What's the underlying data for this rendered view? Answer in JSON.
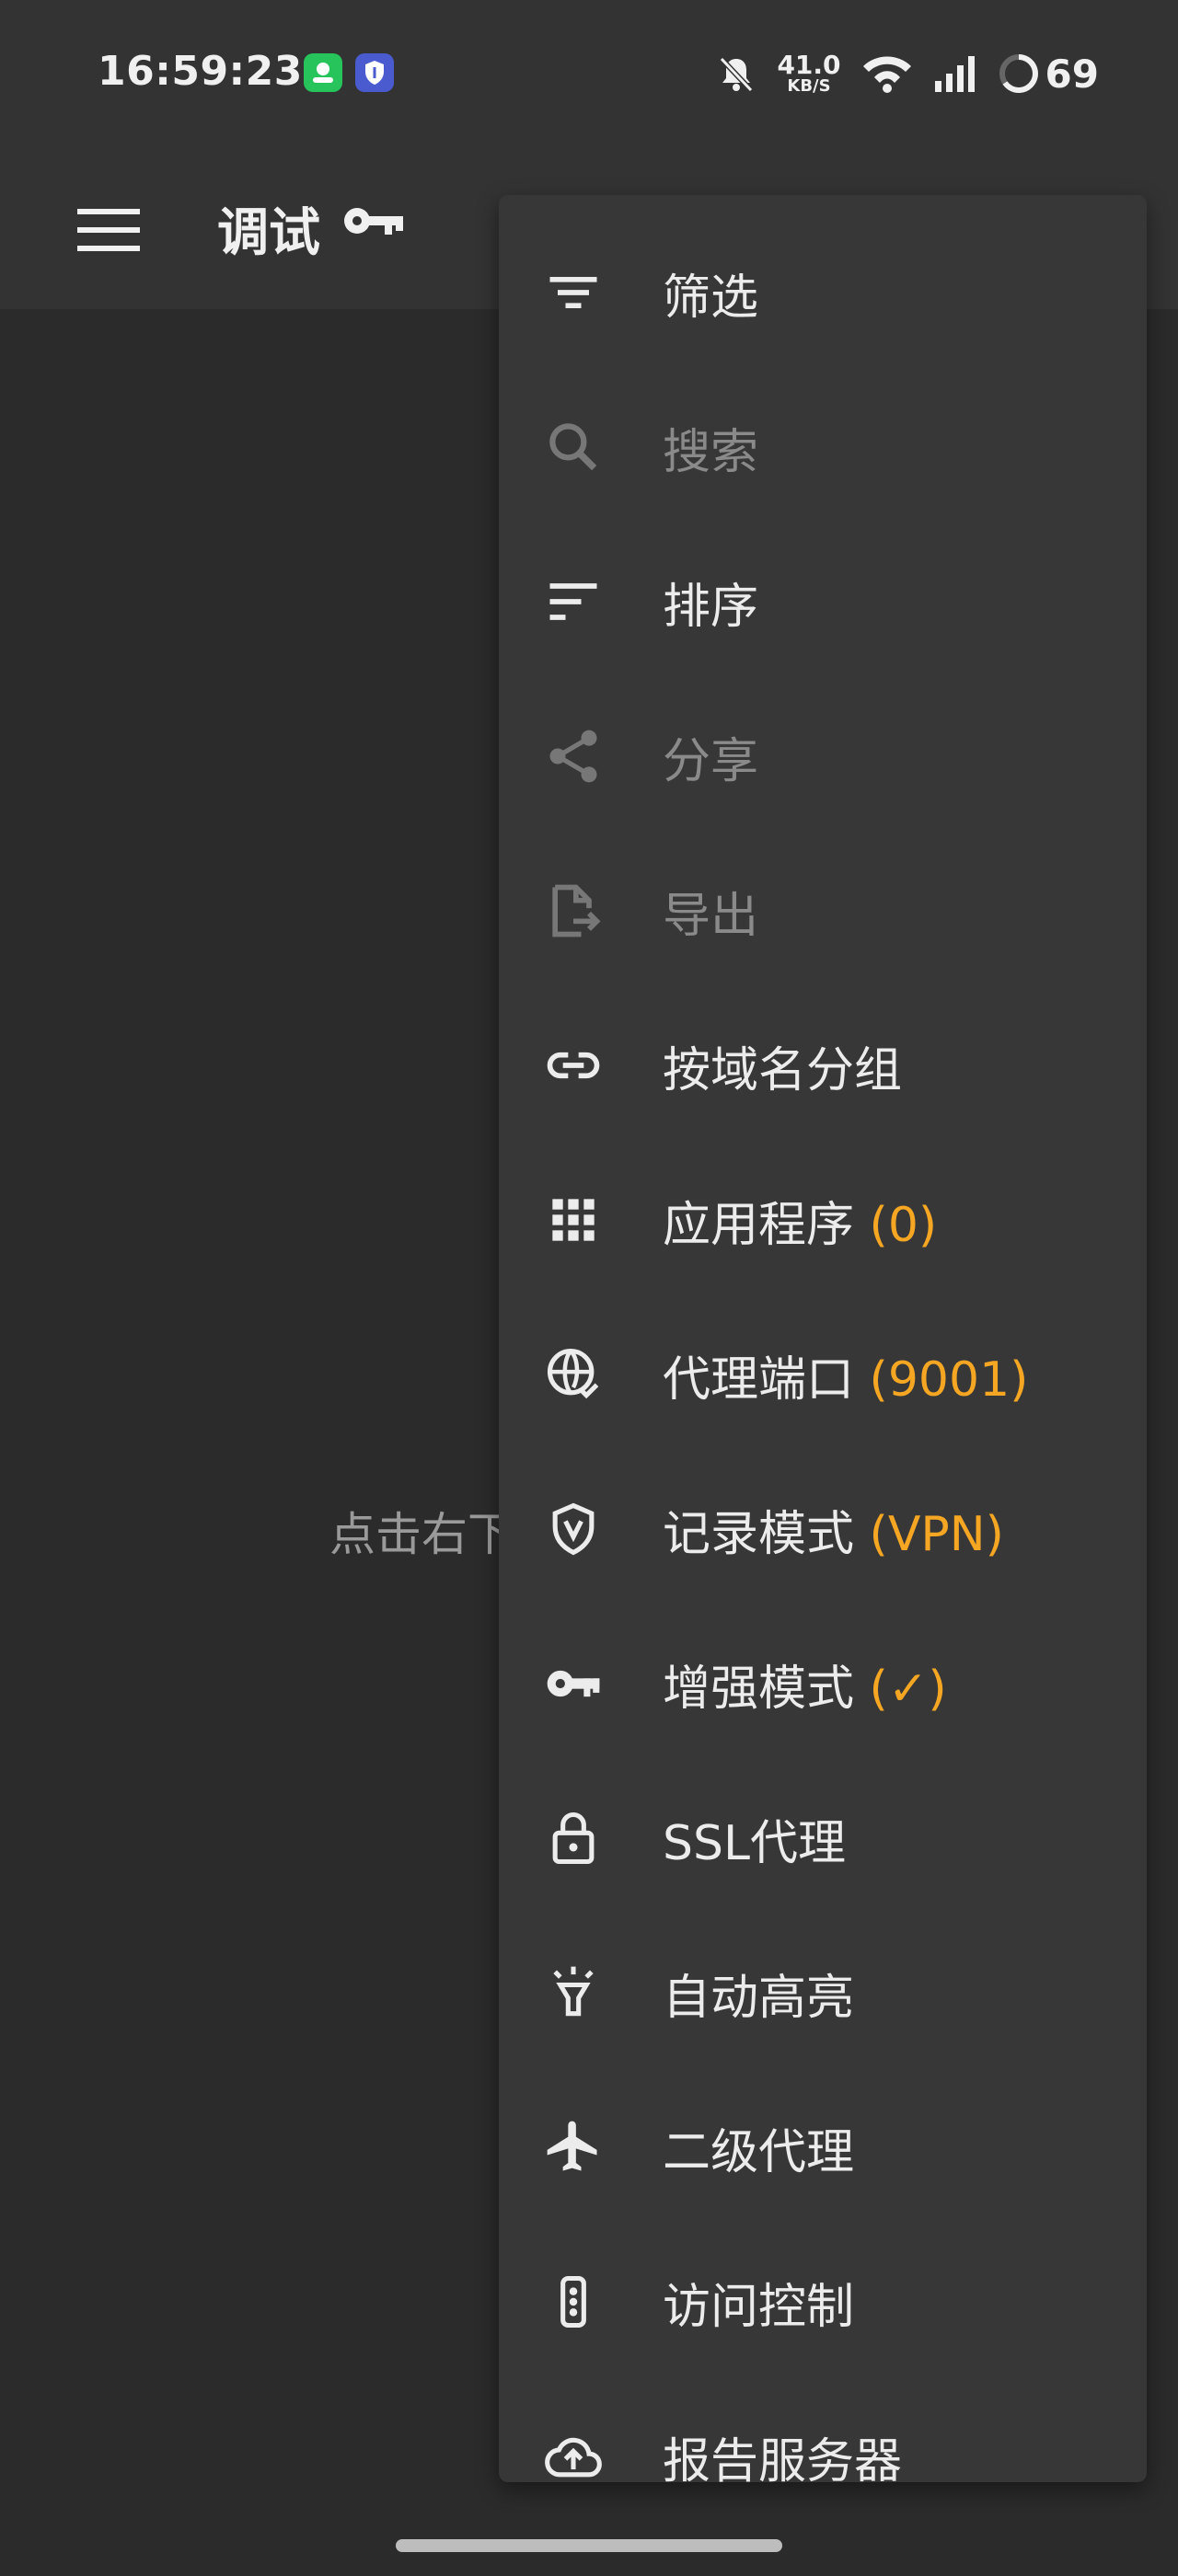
{
  "status_bar": {
    "time": "16:59:23",
    "net_speed_value": "41.0",
    "net_speed_unit": "KB/S",
    "battery": "69",
    "icons": [
      "muted-bell-icon",
      "wifi-icon",
      "signal-icon",
      "battery-ring-icon"
    ]
  },
  "app_bar": {
    "title": "调试",
    "icons": [
      "menu-icon",
      "key-icon"
    ]
  },
  "empty_hint": "点击右下",
  "menu": {
    "items": [
      {
        "id": "filter",
        "label": "筛选",
        "extra": "",
        "icon": "filter-icon",
        "enabled": true
      },
      {
        "id": "search",
        "label": "搜索",
        "extra": "",
        "icon": "search-icon",
        "enabled": false
      },
      {
        "id": "sort",
        "label": "排序",
        "extra": "",
        "icon": "sort-icon",
        "enabled": true
      },
      {
        "id": "share",
        "label": "分享",
        "extra": "",
        "icon": "share-icon",
        "enabled": false
      },
      {
        "id": "export",
        "label": "导出",
        "extra": "",
        "icon": "export-icon",
        "enabled": false
      },
      {
        "id": "group-by-domain",
        "label": "按域名分组",
        "extra": "",
        "icon": "link-icon",
        "enabled": true
      },
      {
        "id": "applications",
        "label": "应用程序",
        "extra": "(0)",
        "icon": "apps-grid-icon",
        "enabled": true
      },
      {
        "id": "proxy-port",
        "label": "代理端口",
        "extra": "(9001)",
        "icon": "globe-check-icon",
        "enabled": true
      },
      {
        "id": "record-mode",
        "label": "记录模式",
        "extra": "(VPN)",
        "icon": "shield-v-icon",
        "enabled": true
      },
      {
        "id": "enhanced-mode",
        "label": "增强模式",
        "extra": "(✓)",
        "icon": "key-icon",
        "enabled": true
      },
      {
        "id": "ssl-proxy",
        "label": "SSL代理",
        "extra": "",
        "icon": "lock-icon",
        "enabled": true
      },
      {
        "id": "auto-highlight",
        "label": "自动高亮",
        "extra": "",
        "icon": "highlight-icon",
        "enabled": true
      },
      {
        "id": "upstream-proxy",
        "label": "二级代理",
        "extra": "",
        "icon": "airplane-icon",
        "enabled": true
      },
      {
        "id": "access-control",
        "label": "访问控制",
        "extra": "",
        "icon": "traffic-light-icon",
        "enabled": true
      },
      {
        "id": "report-server",
        "label": "报告服务器",
        "extra": "",
        "icon": "cloud-upload-icon",
        "enabled": true
      }
    ]
  },
  "colors": {
    "background": "#2b2b2b",
    "bar": "#333333",
    "menu": "#373737",
    "text": "#ececec",
    "disabled": "#8a8a8a",
    "accent": "#f5a623"
  }
}
